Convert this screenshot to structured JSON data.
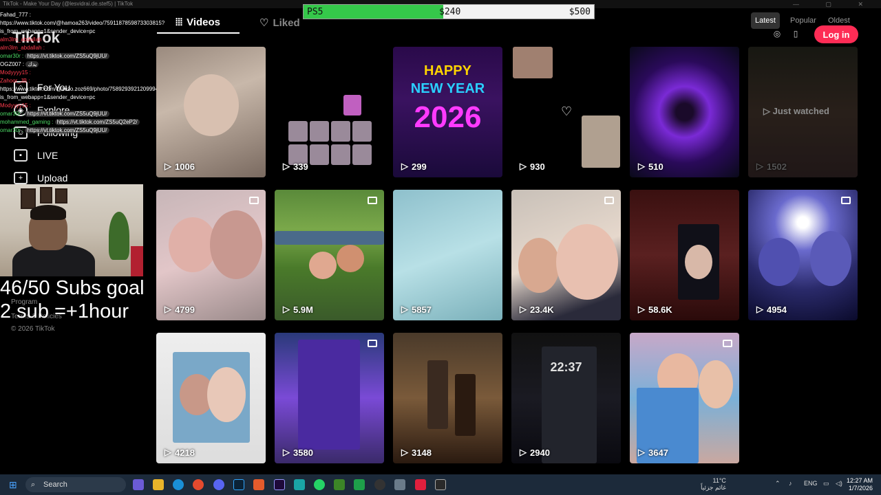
{
  "window": {
    "title": "TikTok - Make Your Day (@lesvidrai.de.stef5) | TikTok"
  },
  "goal_bar": {
    "label": "PS5",
    "current": "$240",
    "target": "$500",
    "progress_fraction": 0.48
  },
  "sidebar": {
    "logo": "TikTok",
    "items": [
      {
        "label": "For You",
        "icon": "home-icon"
      },
      {
        "label": "Explore",
        "icon": "compass-icon"
      },
      {
        "label": "Following",
        "icon": "users-icon"
      },
      {
        "label": "LIVE",
        "icon": "live-icon"
      },
      {
        "label": "Upload",
        "icon": "plus-icon"
      }
    ],
    "footer": {
      "program": "Program",
      "terms": "Terms & Policies",
      "copyright": "© 2026 TikTok"
    }
  },
  "chat": [
    {
      "user": "Fahad_777 :",
      "msg": "",
      "color": "white"
    },
    {
      "user": "",
      "msg": "https://www.tiktok.com/@hamoa263/video/7591187859873303815?",
      "color": "white"
    },
    {
      "user": "",
      "msg": "is_from_webapp=1&sender_device=pc",
      "color": "white"
    },
    {
      "user": "alm3lm_abdallah :",
      "msg": "",
      "color": "red"
    },
    {
      "user": "alm3lm_abdallah :",
      "msg": "",
      "color": "red"
    },
    {
      "user": "omar30r :",
      "msg": "https://vt.tiktok.com/ZS5uQ9jUU/",
      "color": "green"
    },
    {
      "user": "OGZ007 :",
      "msg": "يدك",
      "color": "white"
    },
    {
      "user": "Modyyyy15 :",
      "msg": "",
      "color": "red"
    },
    {
      "user": "Zahoor_JB :",
      "msg": "",
      "color": "red"
    },
    {
      "user": "",
      "msg": "https://www.tiktok.com/@zezo.zoz669/photo/7589293921209994503?",
      "color": "white"
    },
    {
      "user": "",
      "msg": "is_from_webapp=1&sender_device=pc",
      "color": "white"
    },
    {
      "user": "Modyyyy15 :",
      "msg": "",
      "color": "red"
    },
    {
      "user": "omar30r :",
      "msg": "https://vt.tiktok.com/ZS5uQ9jUU/",
      "color": "green"
    },
    {
      "user": "mohammed_gaming :",
      "msg": "https://vt.tiktok.com/ZS5uQ2eP2/",
      "color": "green"
    },
    {
      "user": "omar30r :",
      "msg": "https://vt.tiktok.com/ZS5uQ9jUU/",
      "color": "green"
    }
  ],
  "stream_overlay": {
    "subs_goal_line1": "46/50 Subs goal",
    "subs_goal_line2": "2 sub =+1hour"
  },
  "profile_tabs": {
    "videos": "Videos",
    "liked": "Liked"
  },
  "sort_options": {
    "latest": "Latest",
    "popular": "Popular",
    "oldest": "Oldest"
  },
  "header": {
    "login_label": "Log in"
  },
  "videos": [
    {
      "views": "1006",
      "type": "video"
    },
    {
      "views": "339",
      "type": "video"
    },
    {
      "views": "299",
      "type": "video",
      "overlay_title": "HAPPY",
      "overlay_sub": "NEW YEAR",
      "overlay_year": "2026"
    },
    {
      "views": "930",
      "type": "video"
    },
    {
      "views": "510",
      "type": "video"
    },
    {
      "views": "1502",
      "type": "video",
      "just_watched": "Just watched"
    },
    {
      "views": "4799",
      "type": "photo"
    },
    {
      "views": "5.9M",
      "type": "photo"
    },
    {
      "views": "5857",
      "type": "video"
    },
    {
      "views": "23.4K",
      "type": "photo"
    },
    {
      "views": "58.6K",
      "type": "video"
    },
    {
      "views": "4954",
      "type": "photo"
    },
    {
      "views": "4218",
      "type": "video"
    },
    {
      "views": "3580",
      "type": "photo"
    },
    {
      "views": "3148",
      "type": "video"
    },
    {
      "views": "2940",
      "type": "video",
      "overlay_time": "22:37"
    },
    {
      "views": "3647",
      "type": "photo"
    }
  ],
  "taskbar": {
    "search_label": "Search",
    "weather_temp": "11°C",
    "weather_desc": "غائم جزئياً",
    "lang": "ENG",
    "time": "12:27 AM",
    "date": "1/7/2026"
  }
}
